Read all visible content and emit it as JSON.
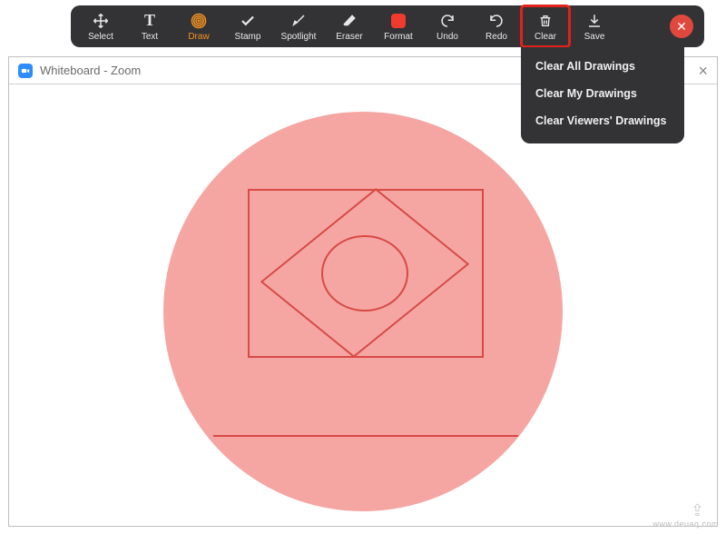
{
  "toolbar": {
    "select": "Select",
    "text": "Text",
    "draw": "Draw",
    "stamp": "Stamp",
    "spotlight": "Spotlight",
    "eraser": "Eraser",
    "format": "Format",
    "undo": "Undo",
    "redo": "Redo",
    "clear": "Clear",
    "save": "Save"
  },
  "window": {
    "title": "Whiteboard - Zoom"
  },
  "clear_menu": {
    "items": [
      "Clear All Drawings",
      "Clear My Drawings",
      "Clear Viewers' Drawings"
    ]
  },
  "colors": {
    "fill": "#f5a6a3",
    "stroke": "#d84a44",
    "accent": "#f6931e",
    "format_swatch": "#f13b2e"
  },
  "watermark": "www.deuaq.com"
}
